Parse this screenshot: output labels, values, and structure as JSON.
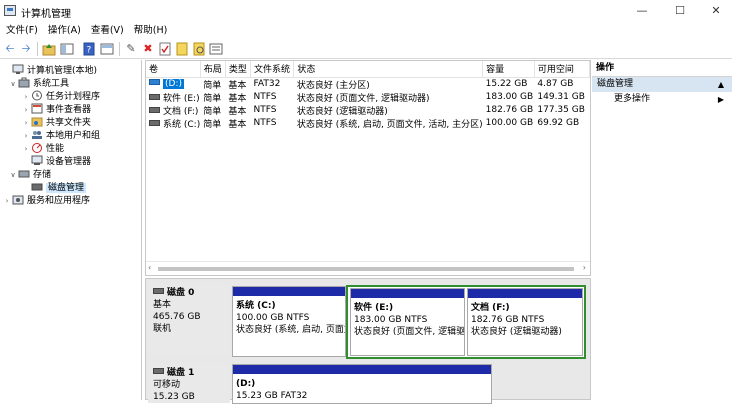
{
  "window": {
    "title": "计算机管理"
  },
  "menu": [
    "文件(F)",
    "操作(A)",
    "查看(V)",
    "帮助(H)"
  ],
  "tree": {
    "root": "计算机管理(本地)",
    "system_tools": "系统工具",
    "task_scheduler": "任务计划程序",
    "event_viewer": "事件查看器",
    "shared_folders": "共享文件夹",
    "local_users": "本地用户和组",
    "performance": "性能",
    "device_manager": "设备管理器",
    "storage": "存储",
    "disk_management": "磁盘管理",
    "services": "服务和应用程序"
  },
  "volumes": {
    "headers": [
      "卷",
      "布局",
      "类型",
      "文件系统",
      "状态",
      "容量",
      "可用空间"
    ],
    "rows": [
      {
        "name": "(D:)",
        "layout": "简单",
        "type": "基本",
        "fs": "FAT32",
        "status": "状态良好 (主分区)",
        "capacity": "15.22 GB",
        "free": "4.87 GB"
      },
      {
        "name": "软件 (E:)",
        "layout": "简单",
        "type": "基本",
        "fs": "NTFS",
        "status": "状态良好 (页面文件, 逻辑驱动器)",
        "capacity": "183.00 GB",
        "free": "149.31 GB"
      },
      {
        "name": "文档 (F:)",
        "layout": "简单",
        "type": "基本",
        "fs": "NTFS",
        "status": "状态良好 (逻辑驱动器)",
        "capacity": "182.76 GB",
        "free": "177.35 GB"
      },
      {
        "name": "系统 (C:)",
        "layout": "简单",
        "type": "基本",
        "fs": "NTFS",
        "status": "状态良好 (系统, 启动, 页面文件, 活动, 主分区)",
        "capacity": "100.00 GB",
        "free": "69.92 GB"
      }
    ]
  },
  "disks": {
    "disk0": {
      "name": "磁盘 0",
      "type": "基本",
      "size": "465.76 GB",
      "status": "联机"
    },
    "disk1": {
      "name": "磁盘 1",
      "type": "可移动",
      "size": "15.23 GB"
    },
    "parts": {
      "c": {
        "title": "系统 (C:)",
        "size": "100.00 GB NTFS",
        "status": "状态良好 (系统, 启动, 页面文件"
      },
      "e": {
        "title": "软件 (E:)",
        "size": "183.00 GB NTFS",
        "status": "状态良好 (页面文件, 逻辑驱"
      },
      "f": {
        "title": "文档 (F:)",
        "size": "182.76 GB NTFS",
        "status": "状态良好 (逻辑驱动器)"
      },
      "d": {
        "title": "(D:)",
        "size": "15.23 GB FAT32"
      }
    }
  },
  "actions": {
    "header": "操作",
    "section": "磁盘管理",
    "more": "更多操作"
  },
  "colors": {
    "partition_bar": "#1d2ba8",
    "selection_border": "#2f8f2f",
    "action_section": "#d7e4f2",
    "selected_volume": "#0078d7"
  }
}
